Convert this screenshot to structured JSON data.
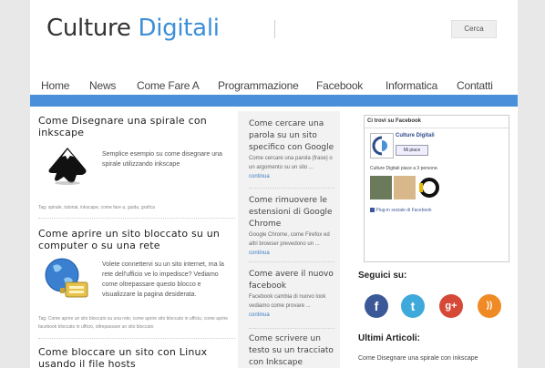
{
  "site": {
    "logo_part1": "Culture",
    "logo_part2": "Digitali"
  },
  "header": {
    "search_button": "Cerca"
  },
  "nav": [
    "Home",
    "News",
    "Come Fare A",
    "Programmazione",
    "Facebook",
    "Informatica",
    "Contatti"
  ],
  "posts": [
    {
      "title": "Come Disegnare una spirale con inkscape",
      "excerpt": "Semplice esempio su come disegnare una spirale utilizzando inkscape",
      "tags": "Tag: spirale, tutorial, inkscape, come fare a, guida, grafica",
      "icon": "inkscape-icon"
    },
    {
      "title": "Come aprire un sito bloccato su un computer o su una rete",
      "excerpt": "Volete connettervi su un sito internet, ma la rete dell'ufficio ve lo impedisce? Vediamo come oltrepassare questo blocco e visualizzare la pagina desiderata.",
      "tags": "Tag: Come aprire un sito bloccato su una rete, come aprire sito bloccato in ufficio, come aprire facebook bloccato in ufficio, oltrepassare un sito bloccato",
      "icon": "network-globe-icon"
    },
    {
      "title": "Come bloccare un sito con Linux usando il file hosts"
    }
  ],
  "column2": [
    {
      "title": "Come cercare una parola su un sito specifico con Google",
      "excerpt": "Come cercare una parola (frase) o un argomento su un sito ...",
      "more": "continua"
    },
    {
      "title": "Come rimuovere le estensioni di Google Chrome",
      "excerpt": "Google Chrome, come Firefox ed altri browser prevedono un ...",
      "more": "continua"
    },
    {
      "title": "Come avere il nuovo facebook",
      "excerpt": "Facebook cambia di nuovo look vediamo come provare ...",
      "more": "continua"
    },
    {
      "title": "Come scrivere un testo su un tracciato con Inkscape"
    }
  ],
  "facebook_box": {
    "header": "Ci trovi su Facebook",
    "page_name": "Culture Digitali",
    "like_label": "Mi piace",
    "count_text": "Culture Digitali piace a 3 persone.",
    "plugin_text": "Plug-in sociale di Facebook"
  },
  "sidebar": {
    "follow_title": "Seguici su:",
    "social": [
      {
        "name": "facebook-icon",
        "glyph": "f",
        "color": "#3b5998"
      },
      {
        "name": "twitter-icon",
        "glyph": "t",
        "color": "#3fa9dc"
      },
      {
        "name": "google-plus-icon",
        "glyph": "g+",
        "color": "#d64937"
      },
      {
        "name": "rss-icon",
        "glyph": "))",
        "color": "#f08a24"
      }
    ],
    "latest_title": "Ultimi Articoli:",
    "latest": [
      "Come Disegnare una spirale con inkscape"
    ]
  }
}
